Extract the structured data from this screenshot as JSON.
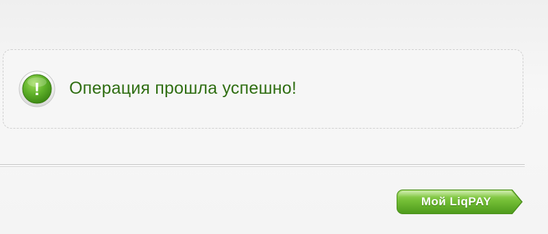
{
  "notice": {
    "message": "Операция прошла успешно!",
    "icon": "exclamation-circle-icon",
    "icon_glyph": "!"
  },
  "actions": {
    "my_liqpay_label": "Мой LiqPAY"
  },
  "colors": {
    "accent_green": "#5aa82a",
    "message_text": "#2f6e12",
    "background": "#f4f4f4"
  }
}
